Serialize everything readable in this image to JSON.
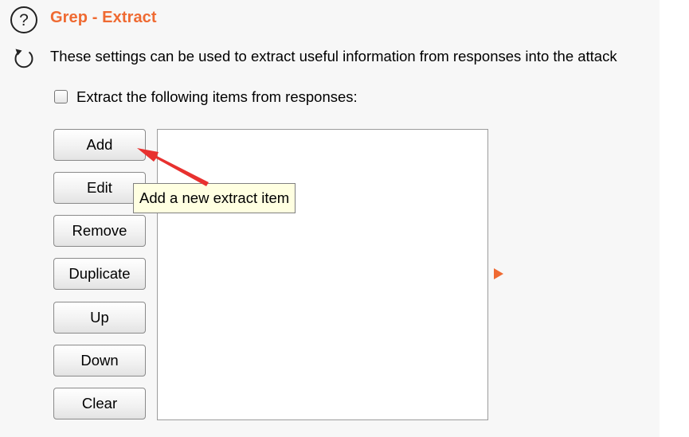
{
  "header": {
    "title": "Grep - Extract",
    "description": "These settings can be used to extract useful information from responses into the attack"
  },
  "option": {
    "label": "Extract the following items from responses:",
    "checked": false
  },
  "buttons": {
    "add": "Add",
    "edit": "Edit",
    "remove": "Remove",
    "duplicate": "Duplicate",
    "up": "Up",
    "down": "Down",
    "clear": "Clear"
  },
  "tooltip": {
    "text": "Add a new extract item"
  },
  "icons": {
    "help": "help-icon",
    "refresh": "refresh-icon",
    "expand": "expand-arrow-icon"
  },
  "colors": {
    "accent": "#ef6a32",
    "tooltip_bg": "#ffffe1",
    "annotation": "#e8312f"
  }
}
